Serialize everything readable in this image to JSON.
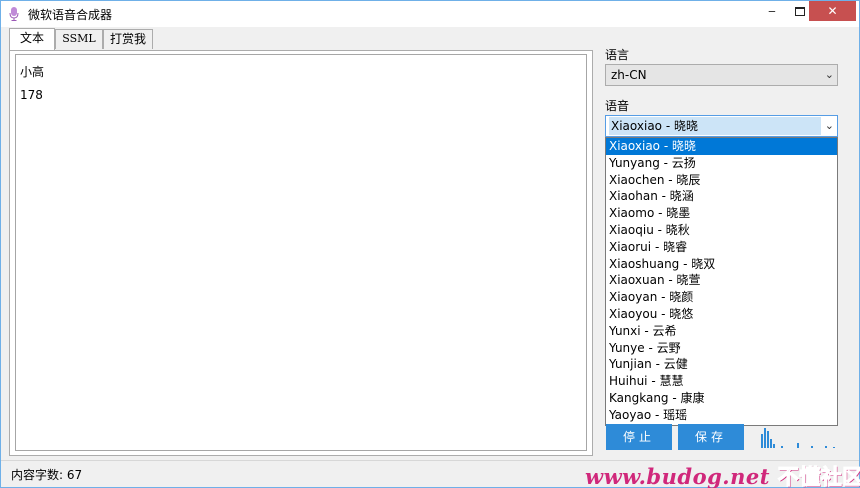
{
  "window": {
    "title": "微软语音合成器",
    "minimize_label": "‒",
    "close_label": "✕"
  },
  "tabs": [
    {
      "label": "文本",
      "active": true
    },
    {
      "label": "SSML",
      "active": false
    },
    {
      "label": "打赏我",
      "active": false
    }
  ],
  "editor": {
    "lines": [
      "小高",
      "178"
    ]
  },
  "status": {
    "text": "内容字数: 67",
    "watermark": "www.budog.net",
    "watermark_cn": "不懂社区"
  },
  "language": {
    "label": "语言",
    "value": "zh-CN"
  },
  "voice": {
    "label": "语音",
    "value": "Xiaoxiao - 晓晓",
    "options": [
      "Xiaoxiao - 晓晓",
      "Yunyang - 云扬",
      "Xiaochen - 晓辰",
      "Xiaohan - 晓涵",
      "Xiaomo - 晓墨",
      "Xiaoqiu - 晓秋",
      "Xiaorui - 晓睿",
      "Xiaoshuang - 晓双",
      "Xiaoxuan - 晓萱",
      "Xiaoyan - 晓颜",
      "Xiaoyou - 晓悠",
      "Yunxi - 云希",
      "Yunye - 云野",
      "Yunjian - 云健",
      "Huihui - 慧慧",
      "Kangkang - 康康",
      "Yaoyao - 瑶瑶"
    ],
    "selected_index": 0
  },
  "buttons": {
    "stop_label": "停止",
    "save_label": "保存"
  },
  "colors": {
    "accent": "#2e8bd8",
    "selection": "#0078d7",
    "close": "#c75050",
    "watermark": "#d0287b"
  }
}
